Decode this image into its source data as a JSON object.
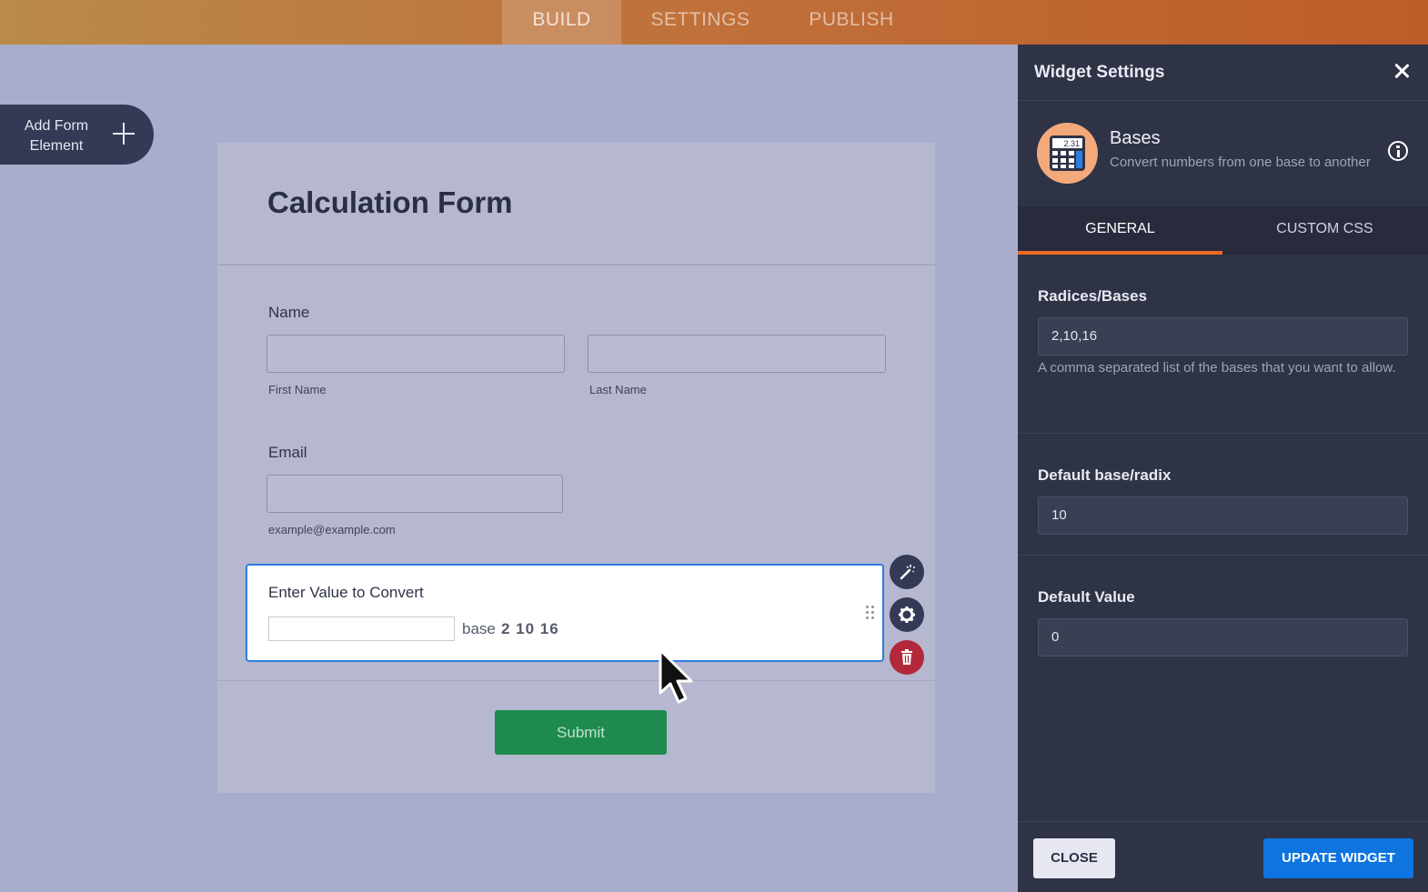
{
  "topbar": {
    "tabs": [
      "BUILD",
      "SETTINGS",
      "PUBLISH"
    ],
    "active": "BUILD"
  },
  "add_element": {
    "label": "Add Form Element"
  },
  "form": {
    "title": "Calculation Form",
    "name_label": "Name",
    "first_name_sub": "First Name",
    "last_name_sub": "Last Name",
    "email_label": "Email",
    "email_sub": "example@example.com",
    "widget_question": "Enter Value to Convert",
    "widget_base_label": "base",
    "widget_bases": "2 10 16",
    "submit_label": "Submit"
  },
  "panel": {
    "title": "Widget Settings",
    "widget_name": "Bases",
    "widget_desc": "Convert numbers from one base to another",
    "widget_icon_text": "2.31",
    "tabs": [
      "GENERAL",
      "CUSTOM CSS"
    ],
    "radices_label": "Radices/Bases",
    "radices_value": "2,10,16",
    "radices_help": "A comma separated list of the bases that you want to allow.",
    "default_base_label": "Default base/radix",
    "default_base_value": "10",
    "default_value_label": "Default Value",
    "default_value_value": "0",
    "close_label": "CLOSE",
    "update_label": "UPDATE WIDGET"
  },
  "colors": {
    "accent_orange": "#ed6b24",
    "update_blue": "#0e75e0",
    "submit_green": "#1e8b4d",
    "selected_blue": "#2f7de0",
    "delete_red": "#b3283a"
  }
}
